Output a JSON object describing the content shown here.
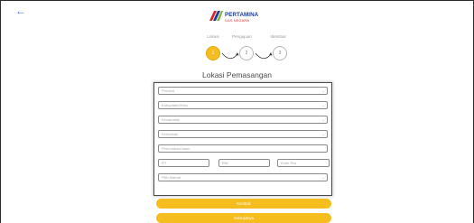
{
  "header": {
    "back_glyph": "←",
    "logo": {
      "brand": "PERTAMINA",
      "sub": "GAS NEGARA"
    }
  },
  "steps": [
    {
      "label": "Lokasi",
      "number": "1",
      "state": "active"
    },
    {
      "label": "Pengajuan",
      "number": "2",
      "state": "inactive"
    },
    {
      "label": "Identitas",
      "number": "3",
      "state": "inactive"
    }
  ],
  "title": "Lokasi Pemasangan",
  "form": {
    "provinsi": {
      "placeholder": "Provinsi",
      "type": "select"
    },
    "kabupaten": {
      "placeholder": "Kabupaten/Kota",
      "type": "select"
    },
    "kecamatan": {
      "placeholder": "Kecamatan",
      "type": "select"
    },
    "kelurahan": {
      "placeholder": "Kelurahan",
      "type": "select"
    },
    "perumahan": {
      "placeholder": "Perumahan/Jalan",
      "type": "text"
    },
    "rt": {
      "placeholder": "RT"
    },
    "rw": {
      "placeholder": "RW"
    },
    "kode_pos": {
      "placeholder": "Kode Pos"
    },
    "pilih_alamat": {
      "placeholder": "Pilih Alamat",
      "type": "select"
    }
  },
  "buttons": {
    "kembali": "Kembali",
    "selanjutnya": "Selanjutnya"
  },
  "colors": {
    "accent": "#f6bd1f",
    "border": "#4a4a4a",
    "logo_blue": "#1a3a8f",
    "logo_red": "#d6262b"
  }
}
